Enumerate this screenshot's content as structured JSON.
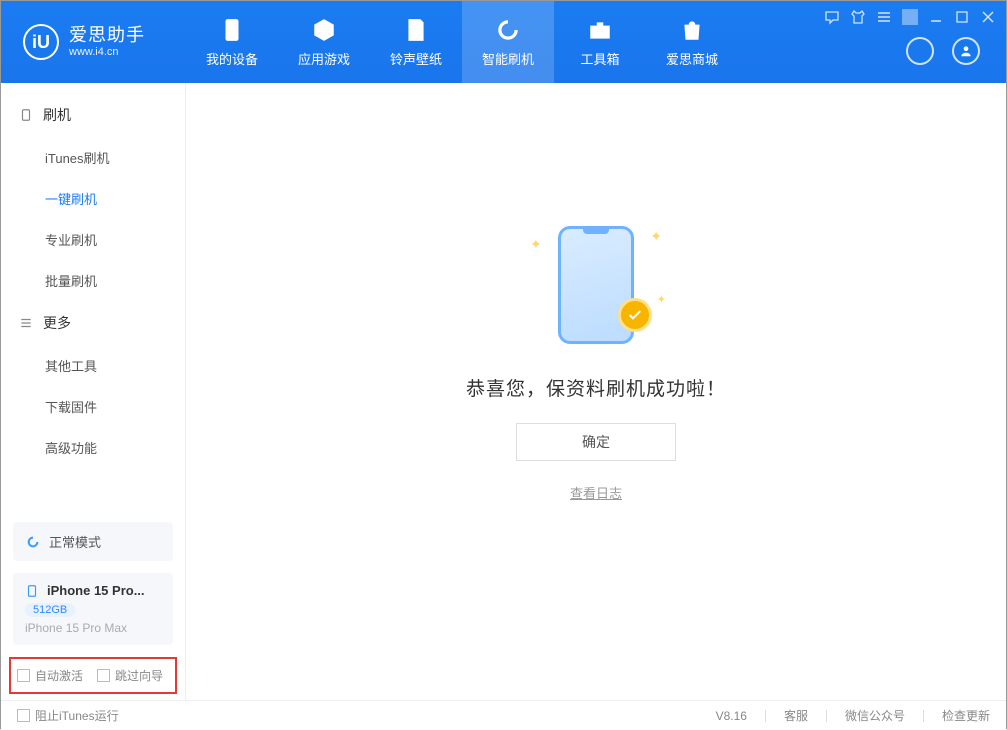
{
  "brand": {
    "title": "爱思助手",
    "sub": "www.i4.cn",
    "logo_glyph": "iU"
  },
  "nav": [
    {
      "label": "我的设备"
    },
    {
      "label": "应用游戏"
    },
    {
      "label": "铃声壁纸"
    },
    {
      "label": "智能刷机"
    },
    {
      "label": "工具箱"
    },
    {
      "label": "爱思商城"
    }
  ],
  "sidebar": {
    "group1": {
      "title": "刷机",
      "items": [
        "iTunes刷机",
        "一键刷机",
        "专业刷机",
        "批量刷机"
      ],
      "active_index": 1
    },
    "group2": {
      "title": "更多",
      "items": [
        "其他工具",
        "下载固件",
        "高级功能"
      ]
    },
    "status_mode": "正常模式",
    "device": {
      "title": "iPhone 15 Pro...",
      "storage": "512GB",
      "model": "iPhone 15 Pro Max"
    },
    "opt_auto_activate": "自动激活",
    "opt_skip_guide": "跳过向导"
  },
  "main": {
    "success_text": "恭喜您，保资料刷机成功啦！",
    "ok_button": "确定",
    "view_log": "查看日志"
  },
  "footer": {
    "block_itunes": "阻止iTunes运行",
    "version": "V8.16",
    "support": "客服",
    "wechat": "微信公众号",
    "check_update": "检查更新"
  }
}
